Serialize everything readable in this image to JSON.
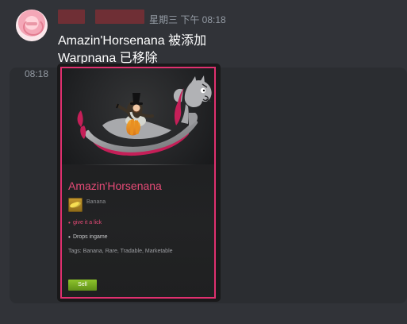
{
  "message": {
    "time_top": "星期三 下午 08:18",
    "line1": "Amazin'Horsenana 被添加",
    "line2": "Warpnana 已移除",
    "side_time": "08:18"
  },
  "card": {
    "title": "Amazin'Horsenana",
    "category": "Banana",
    "bullets": [
      "give it a lick",
      "Drops ingame"
    ],
    "tags": "Tags: Banana, Rare, Tradable, Marketable",
    "button": "Sell"
  },
  "colors": {
    "accent_pink": "#e0306f",
    "accent_green": "#7db92a"
  },
  "icons": {
    "avatar": "avatar",
    "item_icon": "banana-icon"
  }
}
